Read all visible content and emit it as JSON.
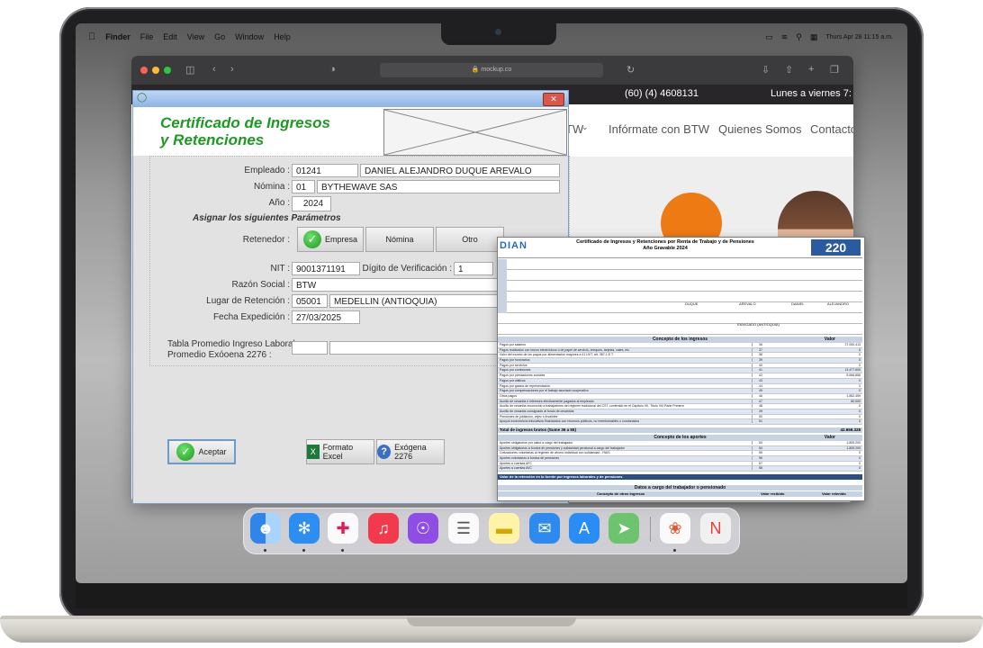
{
  "menubar": {
    "apple": "",
    "app": "Finder",
    "items": [
      "File",
      "Edit",
      "View",
      "Go",
      "Window",
      "Help"
    ],
    "clock": "Thurs Apr 28 11:15 a.m."
  },
  "browser": {
    "address": "mockup.co"
  },
  "website": {
    "phone": "(60) (4) 4608131",
    "hours": "Lunes a viernes 7:",
    "nav": [
      "TW",
      "Infórmate con BTW",
      "Quienes Somos",
      "Contacto"
    ]
  },
  "app": {
    "title_line1": "Certificado de Ingresos",
    "title_line2": "y Retenciones",
    "empleado_label": "Empleado :",
    "empleado_code": "01241",
    "empleado_name": "DANIEL ALEJANDRO DUQUE AREVALO",
    "nomina_label": "Nómina :",
    "nomina_code": "01",
    "nomina_name": "BYTHEWAVE SAS",
    "anio_label": "Año :",
    "anio_value": "2024",
    "params_title": "Asignar los siguientes Parámetros",
    "retenedor_label": "Retenedor :",
    "btn_empresa": "Empresa",
    "btn_nomina": "Nómina",
    "btn_otro": "Otro",
    "nit_label": "NIT :",
    "nit_value": "9001371191",
    "dv_label": "Dígito de Verificación :",
    "dv_value": "1",
    "razon_label": "Razón Social :",
    "razon_value": "BTW",
    "lugar_label": "Lugar de Retención :",
    "lugar_code": "05001",
    "lugar_name": "MEDELLIN (ANTIOQUIA)",
    "fecha_label": "Fecha Expedición :",
    "fecha_value": "27/03/2025",
    "tabla_label1": "Tabla Promedio Ingreso Laboral",
    "tabla_label2": "Promedio Exóoena 2276 :",
    "btn_aceptar": "Aceptar",
    "btn_excel": "Formato Excel",
    "btn_exogena": "Exógena 2276"
  },
  "form": {
    "logo": "DIAN",
    "title": "Certificado de Ingresos y Retenciones por Renta de Trabajo y de Pensiones",
    "subtitle": "Año Gravable 2024",
    "number": "220",
    "section_ingresos": "Concepto de los ingresos",
    "section_aportes": "Concepto de los aportes",
    "section_datos": "Datos a cargo del trabajador o pensionado",
    "col_valor": "Valor",
    "total_ingresos": "Total de ingresos brutos (Sume 36 a 55)",
    "total_value": "42.659.328",
    "valor_retencion": "Valor de la retención en la fuente por ingresos laborales y de pensiones",
    "rows_ingresos": [
      {
        "label": "Pagos por salarios",
        "num": "36",
        "val": "27.000.413"
      },
      {
        "label": "Pagos realizados con bonos electrónicos o de papel de servicio, cheques, tarjetas, vales, etc.",
        "num": "37",
        "val": "0"
      },
      {
        "label": "Valor del exceso de los pagos por alimentación mayores a 41 UVT, art. 387-1 E.T.",
        "num": "38",
        "val": "0"
      },
      {
        "label": "Pagos por honorarios",
        "num": "39",
        "val": "0"
      },
      {
        "label": "Pagos por servicios",
        "num": "40",
        "val": "0"
      },
      {
        "label": "Pagos por comisiones",
        "num": "41",
        "val": "13.477.600"
      },
      {
        "label": "Pagos por prestaciones sociales",
        "num": "42",
        "val": "5.656.856"
      },
      {
        "label": "Pagos por viáticos",
        "num": "43",
        "val": "0"
      },
      {
        "label": "Pagos por gastos de representación",
        "num": "44",
        "val": "0"
      },
      {
        "label": "Pagos por compensaciones por el trabajo asociado cooperativo",
        "num": "45",
        "val": "0"
      },
      {
        "label": "Otros pagos",
        "num": "46",
        "val": "1.852.459"
      },
      {
        "label": "Auxilio de cesantía e intereses efectivamente pagados al empleado",
        "num": "47",
        "val": "60.000"
      },
      {
        "label": "Auxilio de cesantía reconocido a trabajadores del régimen tradicional del CST, contenido en el Capítulo VII, Título VIII Parte Primera",
        "num": "48",
        "val": "0"
      },
      {
        "label": "Auxilio de cesantía consignado al fondo de cesantías",
        "num": "49",
        "val": "0"
      },
      {
        "label": "Pensiones de jubilación, vejez o invalidez",
        "num": "50",
        "val": "0"
      },
      {
        "label": "Apoyos económicos educativos financiados con recursos públicos, no reembolsables o condonados",
        "num": "51",
        "val": "0"
      }
    ],
    "rows_aportes": [
      {
        "label": "Aportes obligatorios por salud a cargo del trabajador",
        "num": "53",
        "val": "1.805.200"
      },
      {
        "label": "Aportes obligatorios a fondos de pensiones y solidaridad pensional a cargo del trabajador",
        "num": "54",
        "val": "1.805.200"
      },
      {
        "label": "Cotizaciones voluntarias al régimen de ahorro individual con solidaridad - RAIS",
        "num": "55",
        "val": "0"
      },
      {
        "label": "Aportes voluntarios a fondos de pensiones",
        "num": "56",
        "val": "0"
      },
      {
        "label": "Aportes a cuentas AFC",
        "num": "57",
        "val": "0"
      },
      {
        "label": "Aportes a cuentas AVC",
        "num": "58",
        "val": "0"
      }
    ],
    "datos_col1": "Concepto de otros ingresos",
    "datos_col2": "Valor recibido",
    "datos_col3": "Valor retenido",
    "employee_last1": "DUQUE",
    "employee_last2": "AREVALO",
    "employee_first": "DANIEL",
    "employee_other": "ALEJANDRO",
    "city": "ENVIGADO (ANTIOQUIA)"
  },
  "dock": [
    "Finder",
    "Safari",
    "Slack",
    "Music",
    "Podcasts",
    "Reminders",
    "Notes",
    "Mail",
    "App Store",
    "Maps",
    "Photos",
    "News"
  ]
}
